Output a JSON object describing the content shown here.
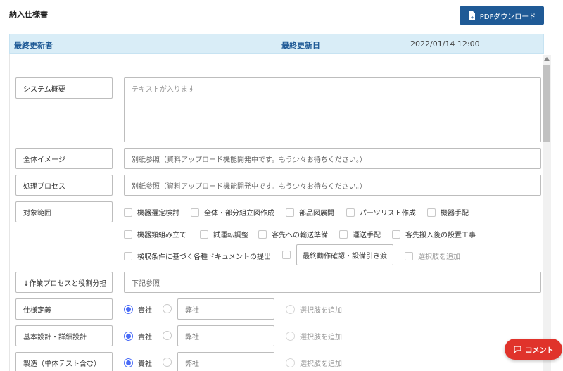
{
  "header": {
    "title": "納入仕様書",
    "pdf_button_label": "PDFダウンロード"
  },
  "meta": {
    "last_updated_by_label": "最終更新者",
    "last_updated_by_value": "",
    "last_updated_date_label": "最終更新日",
    "last_updated_date_value": "2022/01/14 12:00"
  },
  "fields": {
    "system_overview": {
      "label": "システム概要",
      "placeholder": "テキストが入ります"
    },
    "overall_image": {
      "label": "全体イメージ",
      "value": "別紙参照（資料アップロード機能開発中です。もう少々お待ちください。）"
    },
    "process": {
      "label": "処理プロセス",
      "value": "別紙参照（資料アップロード機能開発中です。もう少々お待ちください。）"
    },
    "scope": {
      "label": "対象範囲",
      "options": [
        "機器選定検討",
        "全体・部分組立図作成",
        "部品図展開",
        "パーツリスト作成",
        "機器手配",
        "機器類組み立て",
        "試運転調整",
        "客先への輸送準備",
        "運送手配",
        "客先搬入後の設置工事",
        "検収条件に基づく各種ドキュメントの提出"
      ],
      "inline_button_label": "最終動作確認・設備引き渡",
      "add_option_label": "選択肢を追加"
    },
    "work_process": {
      "label": "↓作業プロセスと役割分担",
      "value": "下記参照"
    },
    "roles": [
      {
        "label": "仕様定義",
        "option_own": "貴社",
        "option_other": "弊社",
        "add_option_label": "選択肢を追加"
      },
      {
        "label": "基本設計・詳細設計",
        "option_own": "貴社",
        "option_other": "弊社",
        "add_option_label": "選択肢を追加"
      },
      {
        "label": "製造（単体テスト含む）",
        "option_own": "貴社",
        "option_other": "弊社",
        "add_option_label": "選択肢を追加"
      }
    ]
  },
  "comment_button_label": "コメント",
  "colors": {
    "primary": "#1f5a96",
    "meta_bg": "#d9edf7",
    "comment": "#e0332b",
    "radio": "#4a6cf7"
  }
}
